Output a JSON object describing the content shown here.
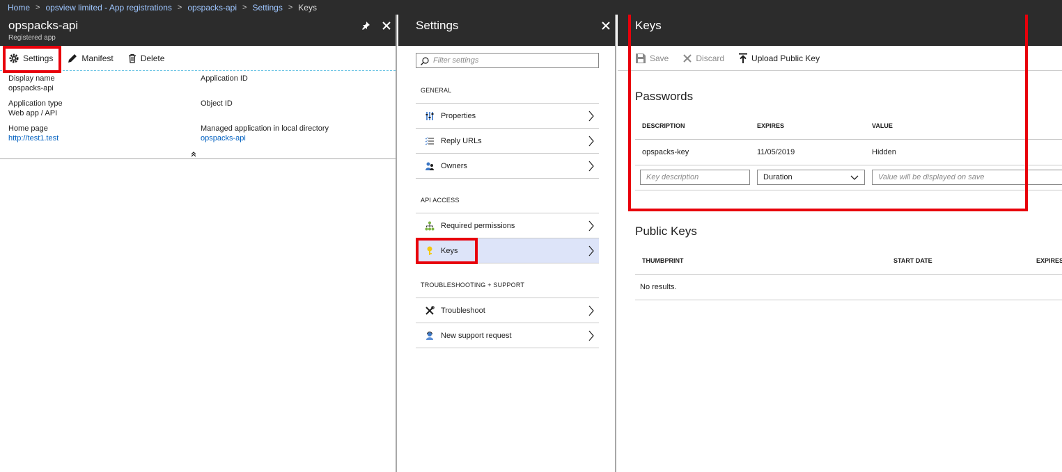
{
  "breadcrumb": [
    "Home",
    "opsview limited - App registrations",
    "opspacks-api",
    "Settings",
    "Keys"
  ],
  "app_blade": {
    "title": "opspacks-api",
    "subtitle": "Registered app",
    "commands": {
      "settings": "Settings",
      "manifest": "Manifest",
      "delete": "Delete"
    },
    "essentials": {
      "display_name_label": "Display name",
      "display_name_value": "opspacks-api",
      "app_type_label": "Application type",
      "app_type_value": "Web app / API",
      "home_page_label": "Home page",
      "home_page_value": "http://test1.test",
      "app_id_label": "Application ID",
      "object_id_label": "Object ID",
      "managed_app_label": "Managed application in local directory",
      "managed_app_value": "opspacks-api"
    }
  },
  "settings_blade": {
    "title": "Settings",
    "filter_placeholder": "Filter settings",
    "sections": {
      "general": "GENERAL",
      "api_access": "API ACCESS",
      "troubleshooting": "TROUBLESHOOTING + SUPPORT"
    },
    "items": {
      "properties": "Properties",
      "reply_urls": "Reply URLs",
      "owners": "Owners",
      "required_permissions": "Required permissions",
      "keys": "Keys",
      "troubleshoot": "Troubleshoot",
      "new_support_request": "New support request"
    }
  },
  "keys_blade": {
    "title": "Keys",
    "commands": {
      "save": "Save",
      "discard": "Discard",
      "upload": "Upload Public Key"
    },
    "passwords": {
      "title": "Passwords",
      "columns": [
        "DESCRIPTION",
        "EXPIRES",
        "VALUE"
      ],
      "rows": [
        {
          "description": "opspacks-key",
          "expires": "11/05/2019",
          "value": "Hidden"
        }
      ],
      "new_row": {
        "description_placeholder": "Key description",
        "duration_value": "Duration",
        "value_placeholder": "Value will be displayed on save"
      }
    },
    "public_keys": {
      "title": "Public Keys",
      "columns": [
        "THUMBPRINT",
        "START DATE",
        "EXPIRES"
      ],
      "empty": "No results."
    }
  },
  "colors": {
    "header": "#2c2c2c",
    "link": "#0060c0",
    "highlight": "#e8000b",
    "selected": "#dde4f9"
  }
}
